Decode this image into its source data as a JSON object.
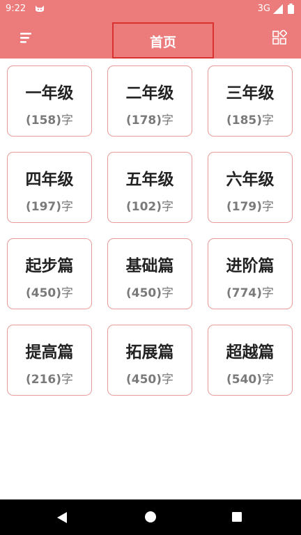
{
  "status_bar": {
    "time": "9:22",
    "network": "3G",
    "app_icon": "notification-cat-icon",
    "signal_icon": "signal-icon",
    "battery_icon": "battery-icon"
  },
  "app_bar": {
    "title": "首页",
    "menu_icon": "menu-icon",
    "grid_icon": "grid-apps-icon",
    "background": "#ec7c7c",
    "highlight_border": "#d9312e"
  },
  "cards": [
    {
      "title": "一年级",
      "count": "158",
      "unit": "字"
    },
    {
      "title": "二年级",
      "count": "178",
      "unit": "字"
    },
    {
      "title": "三年级",
      "count": "185",
      "unit": "字"
    },
    {
      "title": "四年级",
      "count": "197",
      "unit": "字"
    },
    {
      "title": "五年级",
      "count": "102",
      "unit": "字"
    },
    {
      "title": "六年级",
      "count": "179",
      "unit": "字"
    },
    {
      "title": "起步篇",
      "count": "450",
      "unit": "字"
    },
    {
      "title": "基础篇",
      "count": "450",
      "unit": "字"
    },
    {
      "title": "进阶篇",
      "count": "774",
      "unit": "字"
    },
    {
      "title": "提高篇",
      "count": "216",
      "unit": "字"
    },
    {
      "title": "拓展篇",
      "count": "450",
      "unit": "字"
    },
    {
      "title": "超越篇",
      "count": "540",
      "unit": "字"
    }
  ],
  "nav_bar": {
    "back_icon": "back-triangle-icon",
    "home_icon": "home-circle-icon",
    "recents_icon": "recents-square-icon"
  }
}
